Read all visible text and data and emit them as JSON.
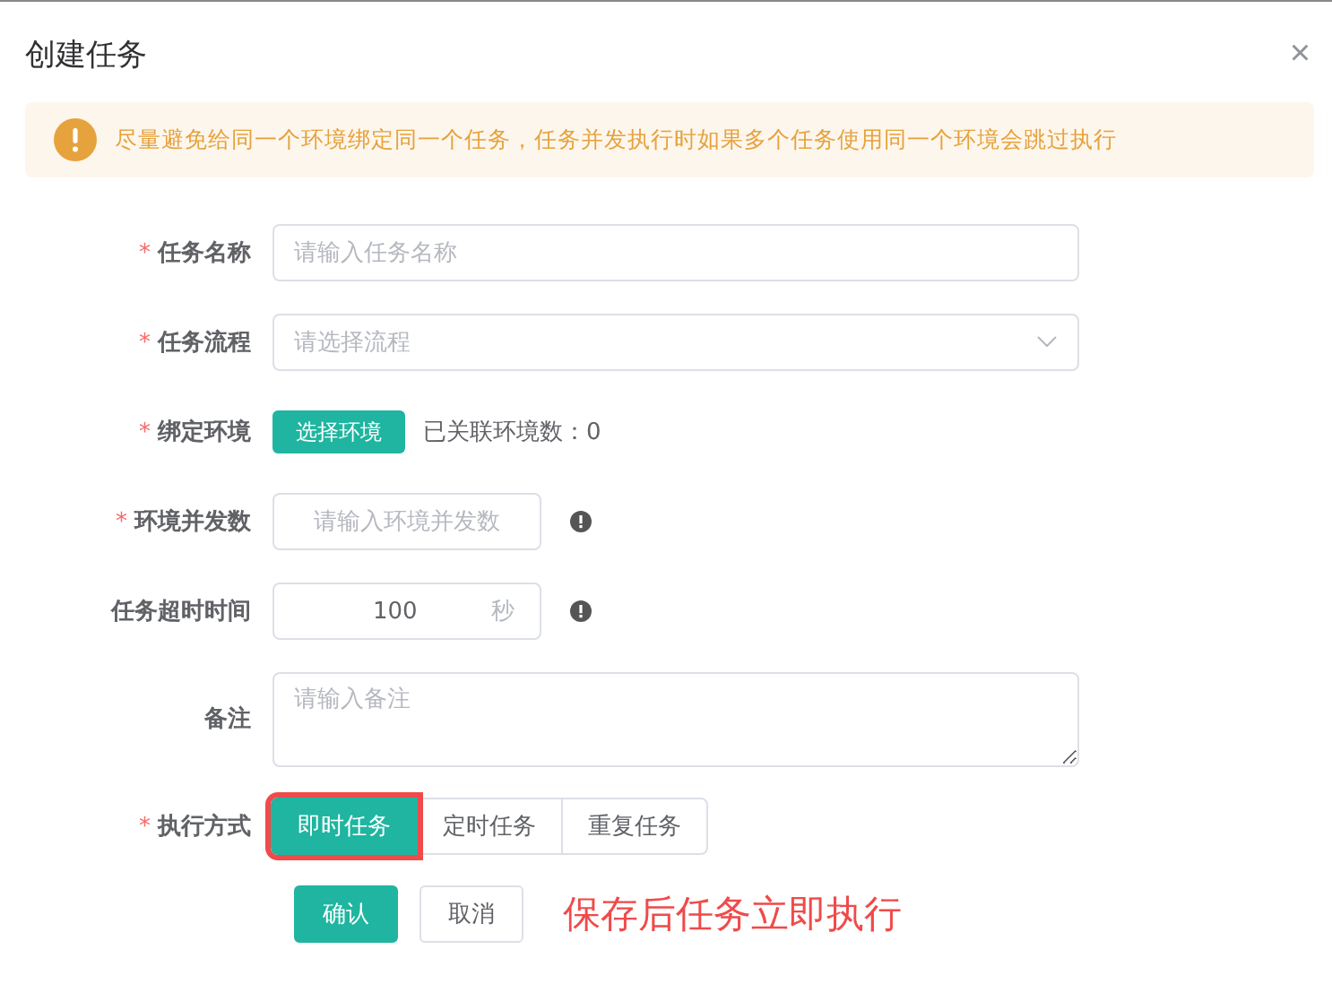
{
  "dialog": {
    "title": "创建任务",
    "close": "×"
  },
  "alert": {
    "text": "尽量避免给同一个环境绑定同一个任务，任务并发执行时如果多个任务使用同一个环境会跳过执行"
  },
  "form": [
    {
      "kind": "input",
      "label": "任务名称",
      "required_mark": "*",
      "placeholder": "请输入任务名称"
    },
    {
      "kind": "select",
      "label": "任务流程",
      "required_mark": "*",
      "placeholder": "请选择流程"
    },
    {
      "kind": "bind",
      "label": "绑定环境",
      "required_mark": "*",
      "button": "选择环境",
      "info": "已关联环境数：0"
    },
    {
      "kind": "short",
      "label": "环境并发数",
      "required_mark": "*",
      "placeholder": "请输入环境并发数",
      "hint": true
    },
    {
      "kind": "short",
      "label": "任务超时时间",
      "value": "100",
      "suffix": "秒",
      "hint": true
    },
    {
      "kind": "textarea",
      "label": "备注",
      "placeholder": "请输入备注"
    },
    {
      "kind": "segments",
      "label": "执行方式",
      "required_mark": "*",
      "options": [
        {
          "label": "即时任务",
          "selected": true,
          "highlighted": true
        },
        {
          "label": "定时任务",
          "selected": false,
          "highlighted": false
        },
        {
          "label": "重复任务",
          "selected": false,
          "highlighted": false
        }
      ]
    }
  ],
  "buttons": [
    {
      "label": "确认",
      "primary": true
    },
    {
      "label": "取消",
      "primary": false
    }
  ],
  "annotation": "保存后任务立即执行"
}
